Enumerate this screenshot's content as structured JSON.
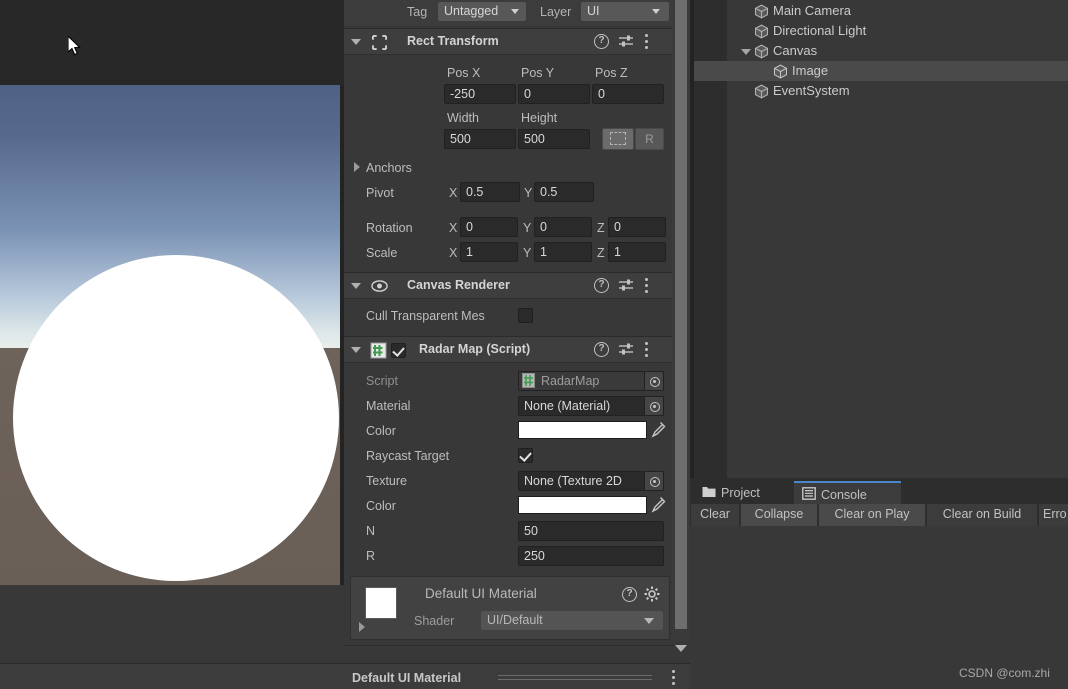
{
  "game_view": {
    "name": "game-view",
    "sky_color_top": "#4f6184",
    "sky_color_horizon": "#e8eeea",
    "ground_color": "#6d635b",
    "shape_color": "#ffffff",
    "shape": "circle"
  },
  "inspector": {
    "tag_label": "Tag",
    "tag_value": "Untagged",
    "layer_label": "Layer",
    "layer_value": "UI",
    "rect_transform": {
      "title": "Rect Transform",
      "anchor_preset_h": "right",
      "anchor_preset_v": "middle",
      "pos_x_label": "Pos X",
      "pos_y_label": "Pos Y",
      "pos_z_label": "Pos Z",
      "pos_x": "-250",
      "pos_y": "0",
      "pos_z": "0",
      "width_label": "Width",
      "height_label": "Height",
      "width": "500",
      "height": "500",
      "blueprint_label": "",
      "raw_label": "R",
      "anchors_label": "Anchors",
      "pivot_label": "Pivot",
      "pivot_x": "0.5",
      "pivot_y": "0.5",
      "rotation_label": "Rotation",
      "rotation_x": "0",
      "rotation_y": "0",
      "rotation_z": "0",
      "scale_label": "Scale",
      "scale_x": "1",
      "scale_y": "1",
      "scale_z": "1",
      "axis_x": "X",
      "axis_y": "Y",
      "axis_z": "Z"
    },
    "canvas_renderer": {
      "title": "Canvas Renderer",
      "cull_label": "Cull Transparent Mes",
      "cull_checked": false
    },
    "radar_map": {
      "title": "Radar Map (Script)",
      "enabled": true,
      "script_label": "Script",
      "script_value": "RadarMap",
      "material_label": "Material",
      "material_value": "None (Material)",
      "color_label": "Color",
      "color_value": "#ffffff",
      "raycast_label": "Raycast Target",
      "raycast_checked": true,
      "texture_label": "Texture",
      "texture_value": "None (Texture 2D",
      "color2_label": "Color",
      "color2_value": "#ffffff",
      "n_label": "N",
      "n_value": "50",
      "r_label": "R",
      "r_value": "250"
    },
    "material_preview": {
      "name": "Default UI Material",
      "shader_label": "Shader",
      "shader_value": "UI/Default"
    },
    "bottom_bar_title": "Default UI Material"
  },
  "hierarchy": {
    "items": [
      {
        "label": "Main Camera",
        "depth": 1,
        "expandable": false,
        "selected": false
      },
      {
        "label": "Directional Light",
        "depth": 1,
        "expandable": false,
        "selected": false
      },
      {
        "label": "Canvas",
        "depth": 1,
        "expandable": true,
        "selected": false
      },
      {
        "label": "Image",
        "depth": 2,
        "expandable": false,
        "selected": true
      },
      {
        "label": "EventSystem",
        "depth": 1,
        "expandable": false,
        "selected": false
      }
    ]
  },
  "console": {
    "tabs": [
      {
        "label": "Project",
        "active": false,
        "icon": "folder-icon"
      },
      {
        "label": "Console",
        "active": true,
        "icon": "console-icon"
      }
    ],
    "toolbar": [
      {
        "label": "Clear",
        "raised": false
      },
      {
        "label": "Collapse",
        "raised": true
      },
      {
        "label": "Clear on Play",
        "raised": true
      },
      {
        "label": "Clear on Build",
        "raised": false
      },
      {
        "label": "Erro",
        "raised": false
      }
    ],
    "accent_color": "#4b86c9"
  },
  "watermark": "CSDN @com.zhi"
}
